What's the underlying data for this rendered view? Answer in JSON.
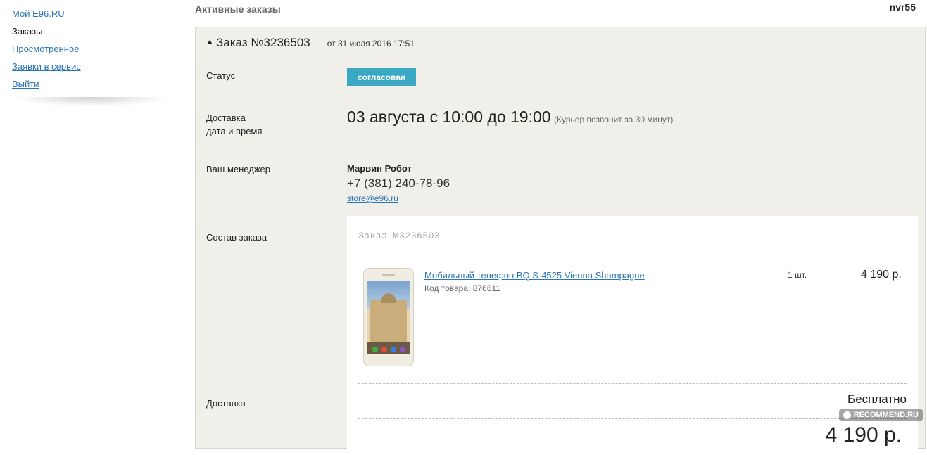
{
  "nav": {
    "items": [
      {
        "label": "Мой Е96.RU",
        "link": true
      },
      {
        "label": "Заказы",
        "link": false
      },
      {
        "label": "Просмотренное",
        "link": true
      },
      {
        "label": "Заявки в сервис",
        "link": true
      },
      {
        "label": "Выйти",
        "link": true
      }
    ]
  },
  "page": {
    "title": "Активные заказы",
    "username": "nvr55"
  },
  "order": {
    "title": "Заказ №3236503",
    "date": "от 31 июля 2016 17:51",
    "status": {
      "label": "Статус",
      "value": "согласован",
      "color": "#3aa8c2"
    },
    "delivery": {
      "label_line1": "Доставка",
      "label_line2": "дата и время",
      "time": "03 августа с 10:00 до 19:00",
      "note": "(Курьер позвонит за 30 минут)"
    },
    "manager": {
      "label": "Ваш менеджер",
      "name": "Марвин Робот",
      "phone": "+7 (381) 240-78-96",
      "email": "store@e96.ru"
    },
    "composition": {
      "label": "Состав заказа",
      "header": "Заказ №3236503",
      "items": [
        {
          "name": "Мобильный телефон BQ S-4525 Vienna Shampagne",
          "code": "Код товара: 876611",
          "qty": "1 шт.",
          "price": "4 190 р.",
          "image_icon": "phone-image"
        }
      ],
      "shipping_label": "Доставка",
      "shipping_value": "Бесплатно",
      "total": "4 190 р."
    }
  },
  "watermark": "RECOMMEND.RU"
}
